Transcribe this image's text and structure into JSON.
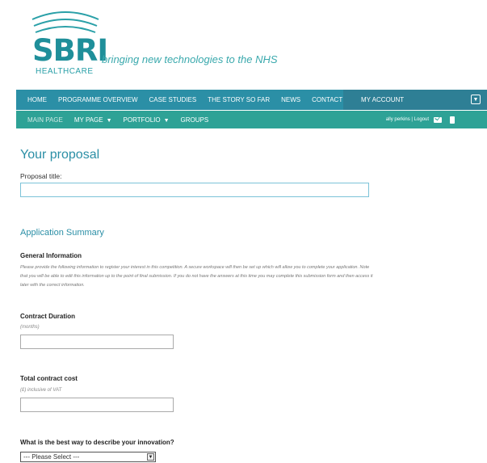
{
  "brand": {
    "logo_text": "SBRI",
    "logo_sub": "HEALTHCARE",
    "tagline": "bringing new technologies to the NHS",
    "colors": {
      "teal_dark": "#2b8fa6",
      "teal_green": "#2ea296",
      "accent": "#1f8f9a"
    }
  },
  "nav_primary": {
    "items": [
      "HOME",
      "PROGRAMME OVERVIEW",
      "CASE STUDIES",
      "THE STORY SO FAR",
      "NEWS",
      "CONTACT US"
    ],
    "account_label": "MY ACCOUNT"
  },
  "nav_secondary": {
    "main_page": "MAIN PAGE",
    "my_page": "MY PAGE",
    "portfolio": "PORTFOLIO",
    "groups": "GROUPS",
    "user_text": "ally perkins | Logout"
  },
  "form": {
    "title": "Your proposal",
    "proposal_title_label": "Proposal title:",
    "proposal_title_value": "",
    "summary_heading": "Application Summary",
    "general_info_heading": "General Information",
    "general_info_text": "Please provide the following information to register your interest in this competition. A secure workspace will then be set up which will allow you to complete your application. Note that you will be able to edit this information up to the point of final submission. If you do not have the answers at this time you may complete this submission form and then access it later with the correct information.",
    "contract_duration_label": "Contract Duration",
    "contract_duration_hint": "(months)",
    "contract_duration_value": "",
    "total_cost_label": "Total contract cost",
    "total_cost_hint": "(£) inclusive of VAT",
    "total_cost_value": "",
    "innovation_label": "What is the best way to describe your innovation?",
    "innovation_selected": "--- Please Select ---"
  }
}
